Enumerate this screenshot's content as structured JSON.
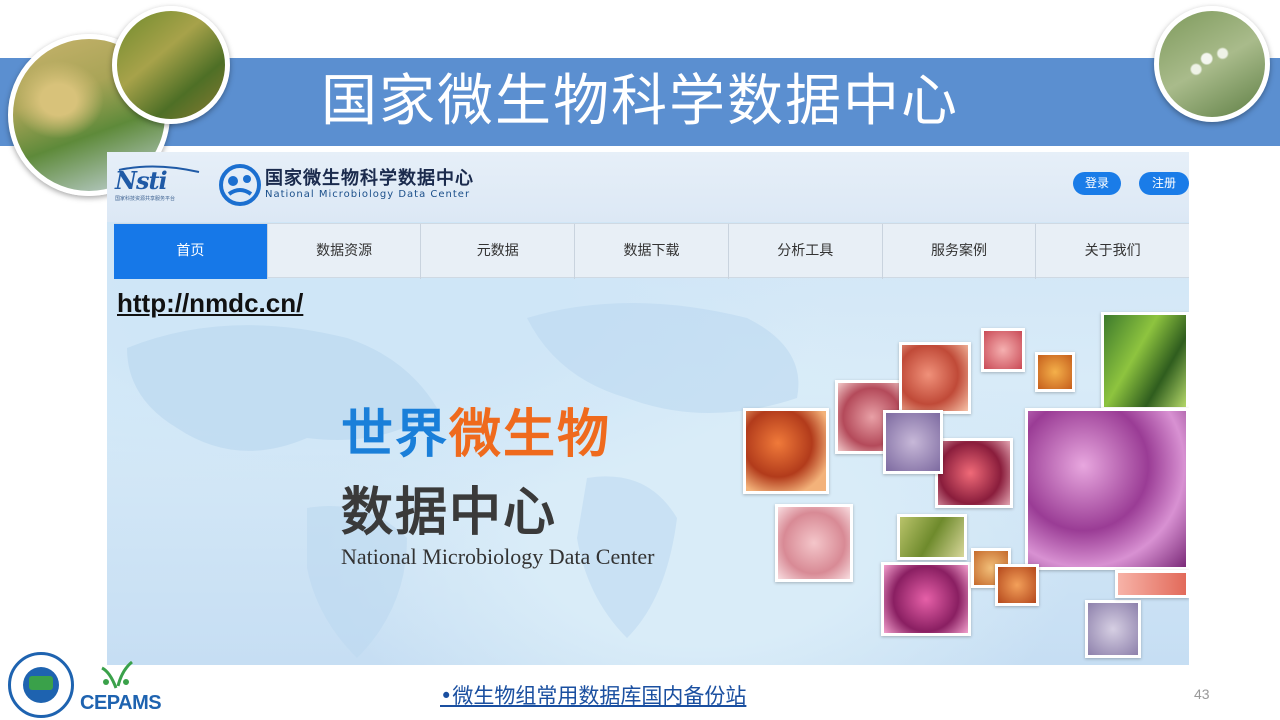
{
  "slide": {
    "title": "国家微生物科学数据中心",
    "page_number": "43",
    "footer_link": "•微生物组常用数据库国内备份站",
    "footer_logo_text": "CEPAMS"
  },
  "website": {
    "nsti_logo_text": "Nsti",
    "nsti_logo_subtext": "国家科技资源共享服务平台",
    "logo_cn": "国家微生物科学数据中心",
    "logo_en": "National Microbiology Data Center",
    "login_label": "登录",
    "register_label": "注册",
    "nav": [
      {
        "label": "首页",
        "active": true
      },
      {
        "label": "数据资源",
        "active": false
      },
      {
        "label": "元数据",
        "active": false
      },
      {
        "label": "数据下载",
        "active": false
      },
      {
        "label": "分析工具",
        "active": false
      },
      {
        "label": "服务案例",
        "active": false
      },
      {
        "label": "关于我们",
        "active": false
      }
    ],
    "url": "http://nmdc.cn/",
    "hero": {
      "line1_part1": "世界",
      "line1_part2": "微生物",
      "line2": "数据中心",
      "en": "National  Microbiology Data Center"
    }
  },
  "colors": {
    "banner": "#5b8fd0",
    "nav_active": "#1678e8",
    "button": "#1a7ce8",
    "hero_blue": "#1a7fd9",
    "hero_orange": "#ef6a1d"
  }
}
